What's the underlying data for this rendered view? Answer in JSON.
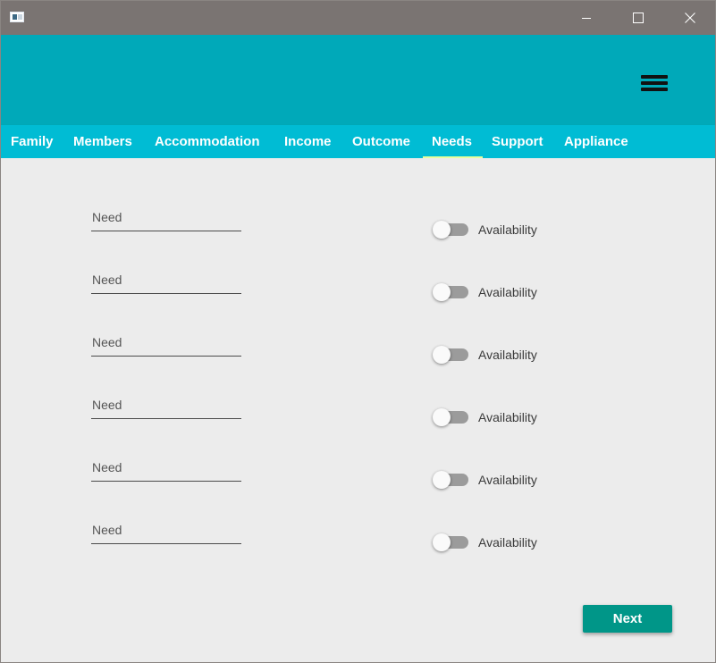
{
  "window": {
    "app_icon": "app-window-icon",
    "controls": [
      "minimize-icon",
      "maximize-icon",
      "close-icon"
    ]
  },
  "header": {
    "menu_icon": "hamburger-menu-icon"
  },
  "tabs": [
    {
      "label": "Family"
    },
    {
      "label": "Members"
    },
    {
      "label": "Accommodation"
    },
    {
      "label": "Income"
    },
    {
      "label": "Outcome"
    },
    {
      "label": "Needs",
      "active": true
    },
    {
      "label": "Support"
    },
    {
      "label": "Appliance"
    }
  ],
  "needs": [
    {
      "placeholder": "Need",
      "value": "",
      "toggle_label": "Availability",
      "available": false
    },
    {
      "placeholder": "Need",
      "value": "",
      "toggle_label": "Availability",
      "available": false
    },
    {
      "placeholder": "Need",
      "value": "",
      "toggle_label": "Availability",
      "available": false
    },
    {
      "placeholder": "Need",
      "value": "",
      "toggle_label": "Availability",
      "available": false
    },
    {
      "placeholder": "Need",
      "value": "",
      "toggle_label": "Availability",
      "available": false
    },
    {
      "placeholder": "Need",
      "value": "",
      "toggle_label": "Availability",
      "available": false
    }
  ],
  "actions": {
    "next_label": "Next"
  },
  "colors": {
    "titlebar": "#7a7472",
    "header": "#00a9b9",
    "tabbar": "#00bcd4",
    "tab_indicator": "#e6ff9e",
    "content_bg": "#ececec",
    "next_button": "#009688",
    "toggle_track_off": "#9b9b9b"
  }
}
